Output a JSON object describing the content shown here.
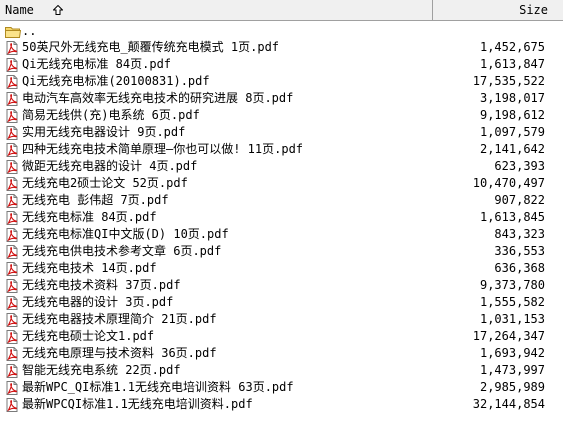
{
  "header": {
    "name_label": "Name",
    "size_label": "Size"
  },
  "rows": [
    {
      "name": "..",
      "size": "",
      "icon": "folder-icon"
    },
    {
      "name": "50英尺外无线充电_颠覆传统充电模式 1页.pdf",
      "size": "1,452,675",
      "icon": "pdf-icon"
    },
    {
      "name": "Qi无线充电标准 84页.pdf",
      "size": "1,613,847",
      "icon": "pdf-icon"
    },
    {
      "name": "Qi无线充电标准(20100831).pdf",
      "size": "17,535,522",
      "icon": "pdf-icon"
    },
    {
      "name": "电动汽车高效率无线充电技术的研究进展 8页.pdf",
      "size": "3,198,017",
      "icon": "pdf-icon"
    },
    {
      "name": "简易无线供(充)电系统 6页.pdf",
      "size": "9,198,612",
      "icon": "pdf-icon"
    },
    {
      "name": "实用无线充电器设计 9页.pdf",
      "size": "1,097,579",
      "icon": "pdf-icon"
    },
    {
      "name": "四种无线充电技术简单原理—你也可以做! 11页.pdf",
      "size": "2,141,642",
      "icon": "pdf-icon"
    },
    {
      "name": "微距无线充电器的设计 4页.pdf",
      "size": "623,393",
      "icon": "pdf-icon"
    },
    {
      "name": "无线充电2硕士论文 52页.pdf",
      "size": "10,470,497",
      "icon": "pdf-icon"
    },
    {
      "name": "无线充电 彭伟超 7页.pdf",
      "size": "907,822",
      "icon": "pdf-icon"
    },
    {
      "name": "无线充电标准 84页.pdf",
      "size": "1,613,845",
      "icon": "pdf-icon"
    },
    {
      "name": "无线充电标准QI中文版(D) 10页.pdf",
      "size": "843,323",
      "icon": "pdf-icon"
    },
    {
      "name": "无线充电供电技术参考文章 6页.pdf",
      "size": "336,553",
      "icon": "pdf-icon"
    },
    {
      "name": "无线充电技术 14页.pdf",
      "size": "636,368",
      "icon": "pdf-icon"
    },
    {
      "name": "无线充电技术资料 37页.pdf",
      "size": "9,373,780",
      "icon": "pdf-icon"
    },
    {
      "name": "无线充电器的设计 3页.pdf",
      "size": "1,555,582",
      "icon": "pdf-icon"
    },
    {
      "name": "无线充电器技术原理简介 21页.pdf",
      "size": "1,031,153",
      "icon": "pdf-icon"
    },
    {
      "name": "无线充电硕士论文1.pdf",
      "size": "17,264,347",
      "icon": "pdf-icon"
    },
    {
      "name": "无线充电原理与技术资料 36页.pdf",
      "size": "1,693,942",
      "icon": "pdf-icon"
    },
    {
      "name": "智能无线充电系统 22页.pdf",
      "size": "1,473,997",
      "icon": "pdf-icon"
    },
    {
      "name": "最新WPC_QI标准1.1无线充电培训资料 63页.pdf",
      "size": "2,985,989",
      "icon": "pdf-icon"
    },
    {
      "name": "最新WPCQI标准1.1无线充电培训资料.pdf",
      "size": "32,144,854",
      "icon": "pdf-icon"
    }
  ]
}
